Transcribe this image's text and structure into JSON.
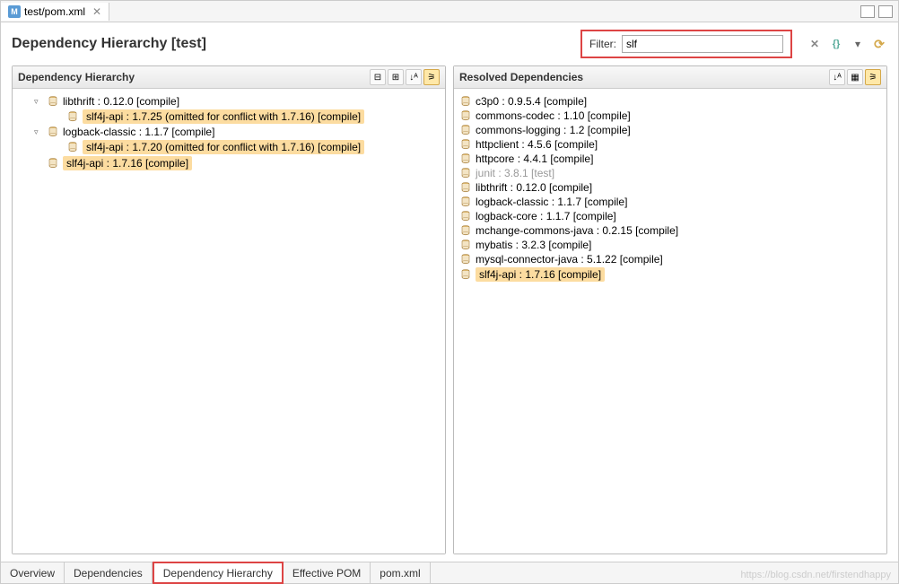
{
  "tab": {
    "filename": "test/pom.xml"
  },
  "title": "Dependency Hierarchy [test]",
  "filter": {
    "label": "Filter:",
    "value": "slf"
  },
  "left_panel": {
    "title": "Dependency Hierarchy",
    "tree": [
      {
        "indent": 1,
        "expander": "▿",
        "text": "libthrift : 0.12.0 [compile]",
        "highlighted": false
      },
      {
        "indent": 2,
        "expander": "",
        "text": "slf4j-api : 1.7.25 (omitted for conflict with 1.7.16) [compile]",
        "highlighted": true
      },
      {
        "indent": 1,
        "expander": "▿",
        "text": "logback-classic : 1.1.7 [compile]",
        "highlighted": false
      },
      {
        "indent": 2,
        "expander": "",
        "text": "slf4j-api : 1.7.20 (omitted for conflict with 1.7.16) [compile]",
        "highlighted": true
      },
      {
        "indent": 1,
        "expander": "",
        "text": "slf4j-api : 1.7.16 [compile]",
        "highlighted": true
      }
    ]
  },
  "right_panel": {
    "title": "Resolved Dependencies",
    "list": [
      {
        "text": "c3p0 : 0.9.5.4 [compile]",
        "highlighted": false,
        "dimmed": false
      },
      {
        "text": "commons-codec : 1.10 [compile]",
        "highlighted": false,
        "dimmed": false
      },
      {
        "text": "commons-logging : 1.2 [compile]",
        "highlighted": false,
        "dimmed": false
      },
      {
        "text": "httpclient : 4.5.6 [compile]",
        "highlighted": false,
        "dimmed": false
      },
      {
        "text": "httpcore : 4.4.1 [compile]",
        "highlighted": false,
        "dimmed": false
      },
      {
        "text": "junit : 3.8.1 [test]",
        "highlighted": false,
        "dimmed": true
      },
      {
        "text": "libthrift : 0.12.0 [compile]",
        "highlighted": false,
        "dimmed": false
      },
      {
        "text": "logback-classic : 1.1.7 [compile]",
        "highlighted": false,
        "dimmed": false
      },
      {
        "text": "logback-core : 1.1.7 [compile]",
        "highlighted": false,
        "dimmed": false
      },
      {
        "text": "mchange-commons-java : 0.2.15 [compile]",
        "highlighted": false,
        "dimmed": false
      },
      {
        "text": "mybatis : 3.2.3 [compile]",
        "highlighted": false,
        "dimmed": false
      },
      {
        "text": "mysql-connector-java : 5.1.22 [compile]",
        "highlighted": false,
        "dimmed": false
      },
      {
        "text": "slf4j-api : 1.7.16 [compile]",
        "highlighted": true,
        "dimmed": false
      }
    ]
  },
  "bottom_tabs": [
    "Overview",
    "Dependencies",
    "Dependency Hierarchy",
    "Effective POM",
    "pom.xml"
  ],
  "active_bottom_tab": 2,
  "watermark": "https://blog.csdn.net/firstendhappy"
}
